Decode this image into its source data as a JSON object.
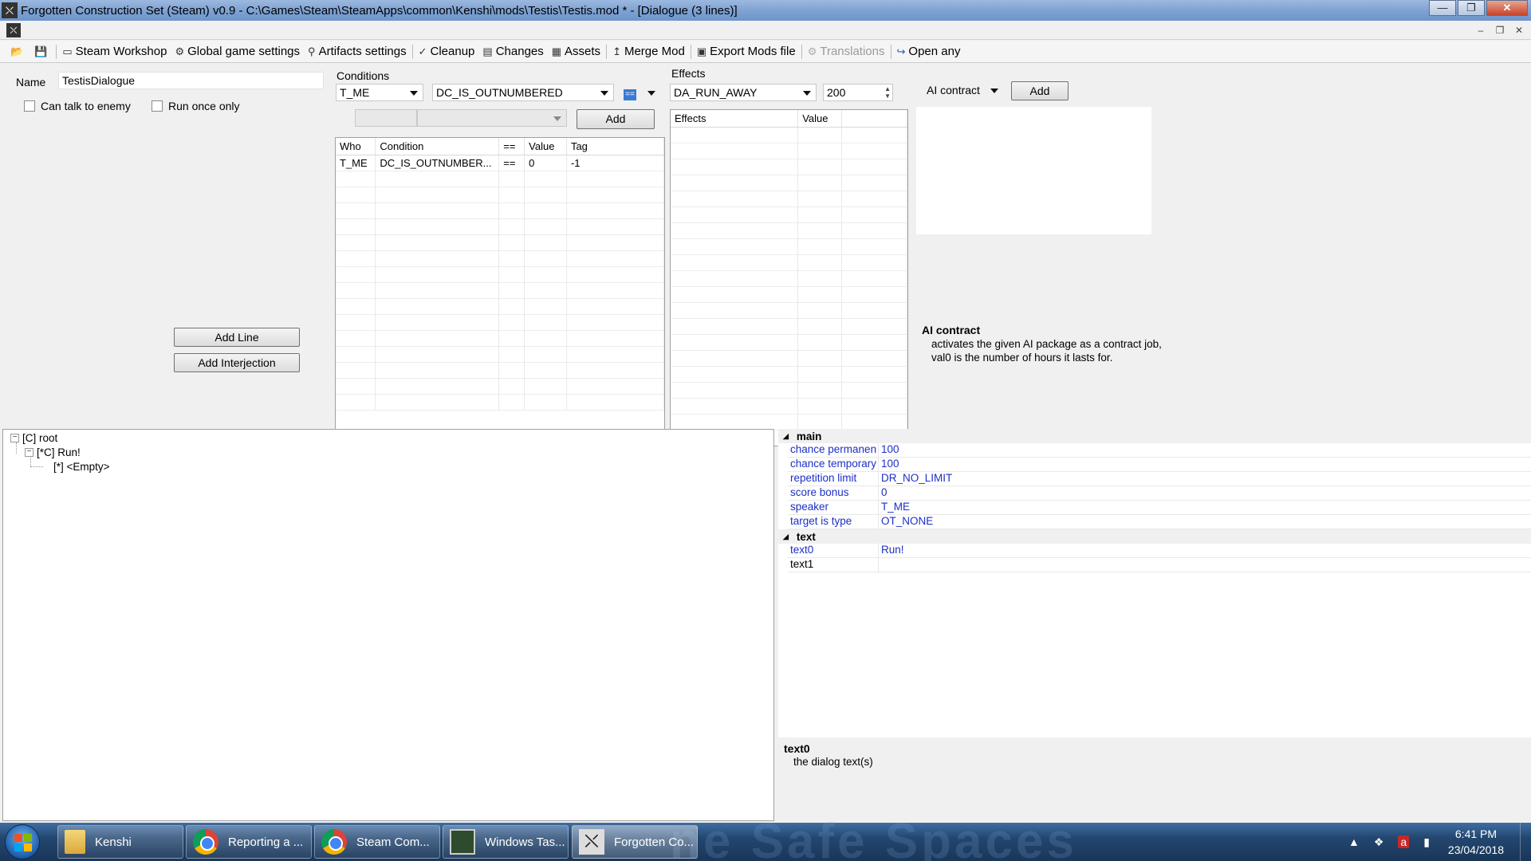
{
  "window": {
    "title": "Forgotten Construction Set (Steam) v0.9 - C:\\Games\\Steam\\SteamApps\\common\\Kenshi\\mods\\Testis\\Testis.mod * - [Dialogue (3 lines)]",
    "min": "—",
    "max": "❐",
    "close": "✕"
  },
  "mdi": {
    "min": "–",
    "restore": "❐",
    "close": "✕"
  },
  "toolbar": {
    "items": [
      {
        "label": "Steam Workshop",
        "icon": "steam-icon"
      },
      {
        "label": "Global game settings",
        "icon": "gear-icon"
      },
      {
        "label": "Artifacts settings",
        "icon": "artifact-icon"
      },
      {
        "label": "Cleanup",
        "icon": "broom-icon"
      },
      {
        "label": "Changes",
        "icon": "changes-icon"
      },
      {
        "label": "Assets",
        "icon": "assets-icon"
      },
      {
        "label": "Merge Mod",
        "icon": "merge-icon"
      },
      {
        "label": "Export Mods file",
        "icon": "export-icon"
      },
      {
        "label": "Translations",
        "icon": "translate-icon",
        "disabled": true
      },
      {
        "label": "Open any",
        "icon": "open-icon"
      }
    ]
  },
  "editor": {
    "name_label": "Name",
    "name_value": "TestisDialogue",
    "can_talk_label": "Can talk to enemy",
    "run_once_label": "Run once only",
    "add_line": "Add Line",
    "add_interjection": "Add Interjection"
  },
  "conditions": {
    "label": "Conditions",
    "who": "T_ME",
    "condition": "DC_IS_OUTNUMBERED",
    "compare": "==",
    "add": "Add",
    "headers": [
      "Who",
      "Condition",
      "==",
      "Value",
      "Tag"
    ],
    "rows": [
      [
        "T_ME",
        "DC_IS_OUTNUMBER...",
        "==",
        "0",
        "-1"
      ]
    ]
  },
  "effects": {
    "label": "Effects",
    "action": "DA_RUN_AWAY",
    "value": "200",
    "headers": [
      "Effects",
      "Value"
    ],
    "rows": []
  },
  "ai": {
    "combo": "AI contract",
    "add": "Add",
    "help_title": "AI contract",
    "help_desc": "activates the given AI package as a contract job, val0 is the number of hours it lasts for."
  },
  "tree": {
    "root": "[C] root",
    "child": "[*C] Run!",
    "leaf": "[*] <Empty>"
  },
  "properties": {
    "main_label": "main",
    "main": [
      {
        "name": "chance permanent",
        "display": "chance permanen",
        "value": "100"
      },
      {
        "name": "chance temporary",
        "display": "chance temporary",
        "value": "100"
      },
      {
        "name": "repetition limit",
        "display": "repetition limit",
        "value": "DR_NO_LIMIT"
      },
      {
        "name": "score bonus",
        "display": "score bonus",
        "value": "0"
      },
      {
        "name": "speaker",
        "display": "speaker",
        "value": "T_ME"
      },
      {
        "name": "target is type",
        "display": "target is type",
        "value": "OT_NONE"
      }
    ],
    "text_label": "text",
    "text": [
      {
        "name": "text0",
        "value": "Run!"
      },
      {
        "name": "text1",
        "value": ""
      }
    ],
    "desc_title": "text0",
    "desc": "the dialog text(s)"
  },
  "taskbar": {
    "watermark": "ne Safe Spaces",
    "tasks": [
      {
        "label": "Kenshi",
        "icon": "folder-icon"
      },
      {
        "label": "Reporting a ...",
        "icon": "chrome-icon"
      },
      {
        "label": "Steam Com...",
        "icon": "chrome-icon"
      },
      {
        "label": "Windows Tas...",
        "icon": "task-manager-icon"
      },
      {
        "label": "Forgotten Co...",
        "icon": "fcs-icon"
      }
    ],
    "time": "6:41 PM",
    "date": "23/04/2018"
  },
  "colors": {
    "property_text": "#1c2fc6",
    "titlebar": "#7a9fd1",
    "taskbar": "#23466f"
  }
}
